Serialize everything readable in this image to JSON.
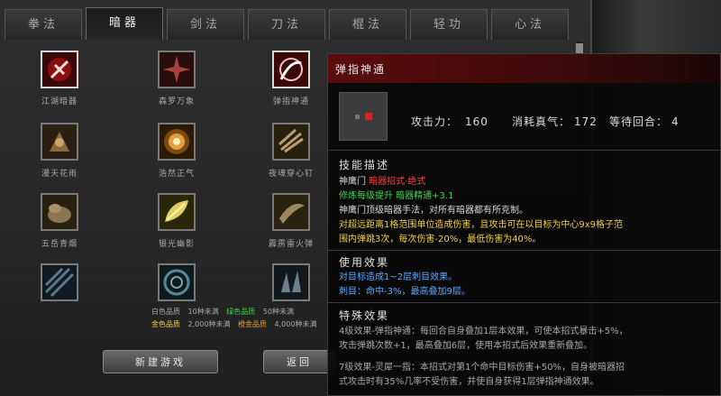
{
  "tabs": [
    "拳法",
    "暗器",
    "剑法",
    "刀法",
    "棍法",
    "轻功",
    "心法"
  ],
  "active_tab": "暗器",
  "skills": [
    {
      "name": "江湖暗器",
      "icon": "feather-red-icon"
    },
    {
      "name": "森罗万象",
      "icon": "sunburst-red-icon"
    },
    {
      "name": "弹指神通",
      "icon": "finger-flick-icon"
    },
    {
      "name": "漫天花雨",
      "icon": "flower-rain-icon"
    },
    {
      "name": "浩然正气",
      "icon": "golden-sun-icon"
    },
    {
      "name": "夜魂穿心钉",
      "icon": "arrow-spikes-icon"
    },
    {
      "name": "五岳青烟",
      "icon": "smoke-icon"
    },
    {
      "name": "银光幽影",
      "icon": "golden-leaf-icon"
    },
    {
      "name": "霹雳雷火弹",
      "icon": "blade-icon"
    },
    {
      "name": "",
      "icon": "streak-icon"
    },
    {
      "name": "",
      "icon": "spiral-icon"
    },
    {
      "name": "",
      "icon": "shards-icon"
    }
  ],
  "stats": {
    "rows": [
      [
        "白色品质",
        "10种未满",
        "绿色品质",
        "50种未满"
      ],
      [
        "金色品质",
        "2,000种未满",
        "橙金品质",
        "4,000种未满"
      ]
    ]
  },
  "buttons": {
    "new_game": "新建游戏",
    "back": "返回"
  },
  "tooltip": {
    "title": "弹指神通",
    "attack_label": "攻击力：",
    "attack_value": "160",
    "cost_label": "消耗真气：",
    "cost_value": "172",
    "wait_label": "等待回合：",
    "wait_value": "4",
    "desc_header": "技能描述",
    "desc_school": "神鹰门",
    "desc_type": "暗器招式·绝式",
    "desc_levelup": "修炼每级提升 暗器精通+3.1",
    "desc_text": "神鹰门顶级暗器手法，对所有暗器都有所克制。",
    "desc_effect_1": "对超远距离1格范围单位造成伤害，且攻击可在以目标为中心9x9格子范",
    "desc_effect_2": "围内弹跳3次，每次伤害-20%，最低伤害为40%。",
    "use_header": "使用效果",
    "use_1": "对目标造成1~2层刺目效果。",
    "use_2": "刺目：命中-3%，最高叠加9层。",
    "special_header": "特殊效果",
    "special_1a": "4级效果-弹指神通：每回合自身叠加1层本效果，可使本招式暴击+5%，",
    "special_1b": "攻击弹跳次数+1，最高叠加6层，使用本招式后效果重新叠加。",
    "special_2a": "7级效果-灵犀一指：本招式对第1个命中目标伤害+50%，自身被暗器招",
    "special_2b": "式攻击时有35%几率不受伤害，并使自身获得1层弹指神通效果。"
  },
  "colors": {
    "red": "#ff3c3c",
    "green": "#3fd24a",
    "yellow": "#f0d040",
    "blue": "#5aa8ff"
  }
}
